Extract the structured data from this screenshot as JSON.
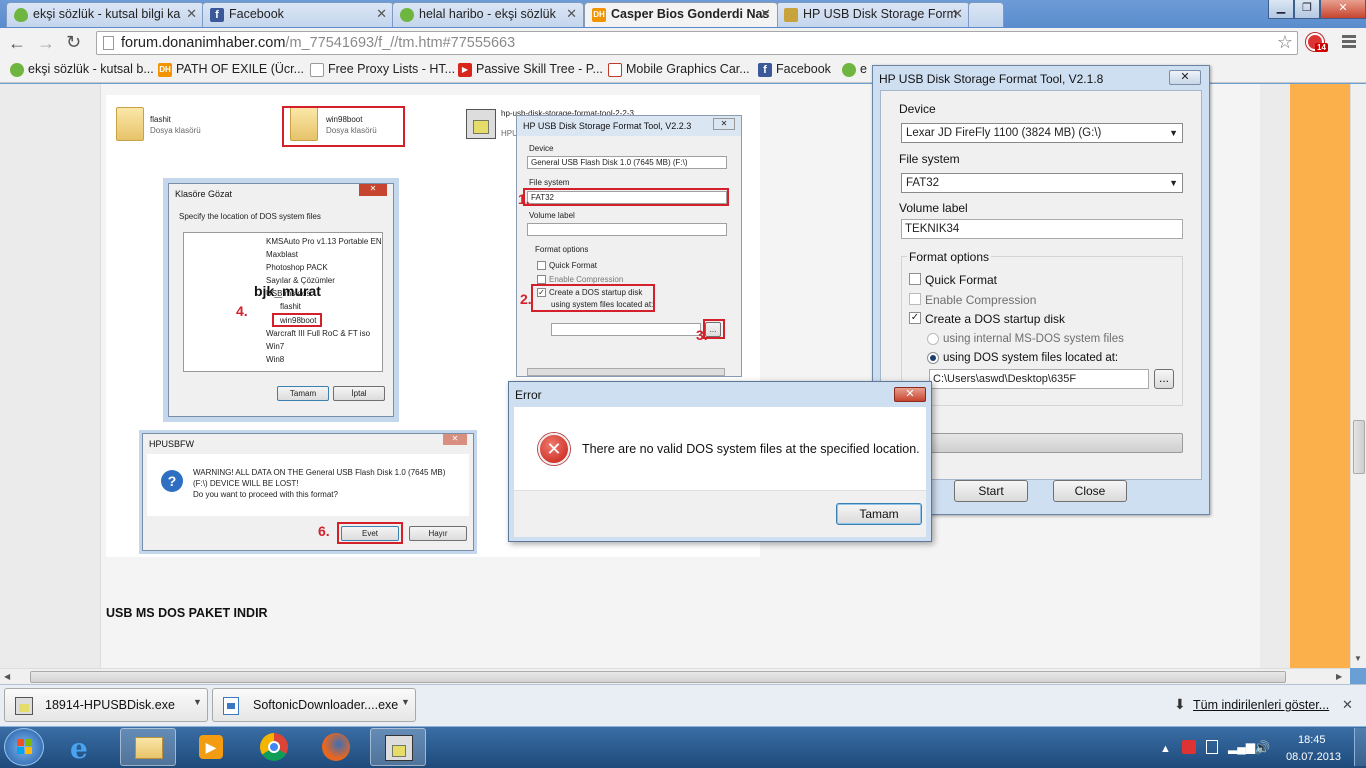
{
  "tabs": [
    {
      "title": "ekşi sözlük - kutsal bilgi ka",
      "icon": "eksi-drop-icon",
      "color": "#6fb640"
    },
    {
      "title": "Facebook",
      "icon": "facebook-icon",
      "color": "#3b5998"
    },
    {
      "title": "helal haribo - ekşi sözlük",
      "icon": "eksi-drop-icon",
      "color": "#6fb640"
    },
    {
      "title": "Casper Bios Gonderdi Nas",
      "icon": "dh-logo-icon",
      "color": "#f29400"
    },
    {
      "title": "HP USB Disk Storage Form",
      "icon": "hp-favicon-icon",
      "color": "#c8a23a"
    }
  ],
  "address": {
    "host": "forum.donanimhaber.com",
    "path": "/m_77541693/f_//tm.htm#77555663"
  },
  "extension_badge": "14",
  "bookmarks": [
    {
      "label": "ekşi sözlük - kutsal b...",
      "icon": "eksi-drop-icon",
      "color": "#6fb640"
    },
    {
      "label": "PATH OF EXILE (Ücr...",
      "icon": "dh-logo-icon",
      "color": "#f29400"
    },
    {
      "label": "Free Proxy Lists - HT...",
      "icon": "page-icon",
      "color": "#ffffff"
    },
    {
      "label": "Passive Skill Tree - P...",
      "icon": "youtube-icon",
      "color": "#d9261c"
    },
    {
      "label": "Mobile Graphics Car...",
      "icon": "shield-icon",
      "color": "#c0392b"
    },
    {
      "label": "Facebook",
      "icon": "facebook-icon",
      "color": "#3b5998"
    },
    {
      "label": "e",
      "icon": "eksi-drop-icon",
      "color": "#6fb640"
    }
  ],
  "screenshot": {
    "folder1_name": "flashit",
    "folder1_type": "Dosya klasörü",
    "folder2_name": "win98boot",
    "folder2_type": "Dosya klasörü",
    "file3_name": "hp-usb-disk-storage-format-tool-2-2-3",
    "file3_sub": "HPU",
    "browse_title": "Klasöre Gözat",
    "browse_prompt": "Specify the location of DOS system files",
    "tree": [
      "KMSAuto Pro v1.13 Portable EN",
      "Maxblast",
      "Photoshop PACK",
      "Sayılar & Çözümler",
      "USB ms dos",
      "flashit",
      "win98boot",
      "Warcraft III Full RoC & FT iso",
      "Win7",
      "Win8"
    ],
    "watermark": "bjk_murat",
    "browse_ok": "Tamam",
    "browse_cancel": "İptal",
    "mini_hp_title": "HP USB Disk Storage Format Tool, V2.2.3",
    "mini_device_label": "Device",
    "mini_device_value": "General  USB Flash Disk   1.0 (7645 MB) (F:\\)",
    "mini_fs_label": "File system",
    "mini_fs_value": "FAT32",
    "mini_volume_label": "Volume label",
    "mini_format_options": "Format options",
    "mini_quick": "Quick Format",
    "mini_compression": "Enable Compression",
    "mini_dos_line1": "Create a DOS startup disk",
    "mini_dos_line2": "using system files located at:",
    "mini_browse": "...",
    "confirm_title": "HPUSBFW",
    "confirm_line1": "WARNING! ALL DATA ON THE General  USB Flash Disk  1.0 (7645 MB)",
    "confirm_line2": "(F:\\) DEVICE WILL BE LOST!",
    "confirm_line3": "Do you want to proceed with this format?",
    "confirm_yes": "Evet",
    "confirm_no": "Hayır",
    "steps": [
      "1.",
      "2.",
      "3.",
      "4.",
      "6."
    ]
  },
  "page_heading": "USB MS DOS PAKET INDIR",
  "hp_tool": {
    "title": "HP USB Disk Storage Format Tool, V2.1.8",
    "device_label": "Device",
    "device_value": "Lexar JD FireFly 1100 (3824 MB) (G:\\)",
    "fs_label": "File system",
    "fs_value": "FAT32",
    "volume_label": "Volume label",
    "volume_value": "TEKNIK34",
    "format_options": "Format options",
    "quick_format": "Quick Format",
    "enable_compression": "Enable Compression",
    "create_dos": "Create a DOS startup disk",
    "internal_msdos": "using internal MS-DOS system files",
    "dos_files_at": "using DOS system files located at:",
    "path_value": "C:\\Users\\aswd\\Desktop\\635F",
    "browse": "...",
    "start": "Start",
    "close": "Close"
  },
  "error_dialog": {
    "title": "Error",
    "message": "There are no valid DOS system files at the specified location.",
    "ok": "Tamam"
  },
  "downloads": [
    {
      "name": "18914-HPUSBDisk.exe"
    },
    {
      "name": "SoftonicDownloader....exe"
    }
  ],
  "downloads_show_all": "Tüm indirilenleri göster...",
  "clock": {
    "time": "18:45",
    "date": "08.07.2013"
  }
}
